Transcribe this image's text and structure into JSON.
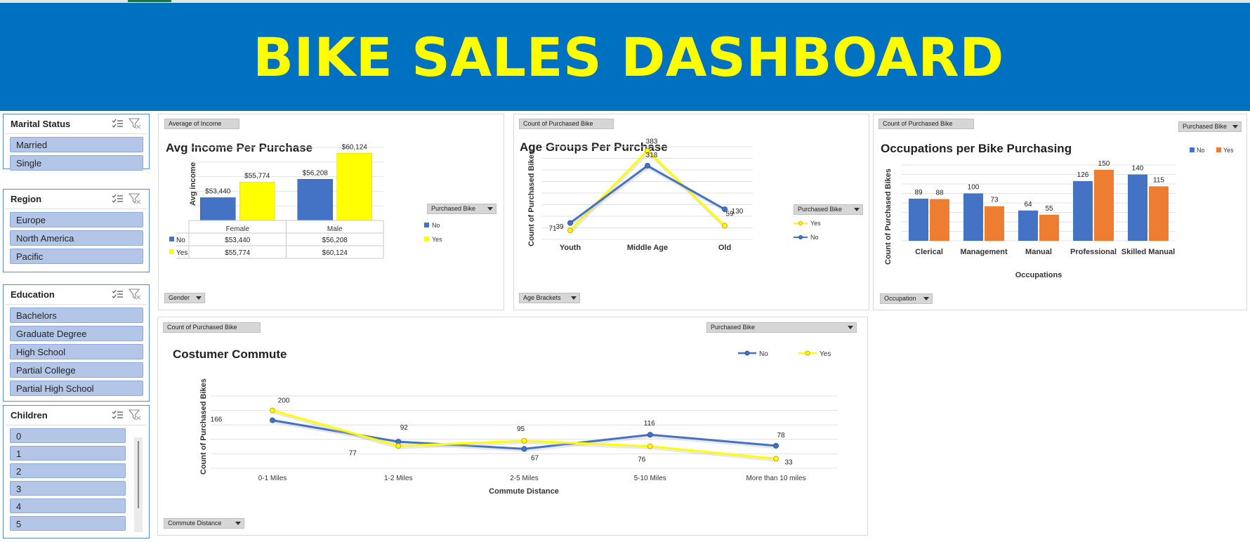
{
  "banner": {
    "title": "BIKE SALES DASHBOARD"
  },
  "colors": {
    "banner_bg": "#0070c0",
    "banner_text": "#ffff00",
    "no": "#4472c4",
    "yes_yellow": "#ffff00",
    "yes_orange": "#ed7d31",
    "slicer_item": "#b4c6e7"
  },
  "icons": {
    "multiselect": "multi-select-icon",
    "clear_filter": "clear-filter-icon",
    "dropdown": "dropdown-arrow-icon"
  },
  "slicers": {
    "marital": {
      "title": "Marital Status",
      "items": [
        "Married",
        "Single"
      ]
    },
    "region": {
      "title": "Region",
      "items": [
        "Europe",
        "North America",
        "Pacific"
      ]
    },
    "education": {
      "title": "Education",
      "items": [
        "Bachelors",
        "Graduate Degree",
        "High School",
        "Partial College",
        "Partial High School"
      ]
    },
    "children": {
      "title": "Children",
      "items": [
        "0",
        "1",
        "2",
        "3",
        "4",
        "5"
      ]
    }
  },
  "income_panel": {
    "field_value": "Average of Income",
    "field_axis": "Gender",
    "legend_title": "Purchased Bike",
    "table_rows": [
      {
        "key": "No",
        "cells": [
          "$53,440",
          "$56,208"
        ]
      },
      {
        "key": "Yes",
        "cells": [
          "$55,774",
          "$60,124"
        ]
      }
    ]
  },
  "age_panel": {
    "field_value": "Count of Purchased Bike",
    "field_axis": "Age Brackets",
    "legend_title": "Purchased Bike"
  },
  "occupation_panel": {
    "field_value": "Count of Purchased Bike",
    "field_axis": "Occupation",
    "field_legend": "Purchased Bike"
  },
  "commute_panel": {
    "field_value": "Count of Purchased Bike",
    "field_axis": "Commute Distance",
    "field_legend": "Purchased Bike"
  },
  "chart_data": [
    {
      "id": "income",
      "type": "bar",
      "title": "Avg Income Per Purchase",
      "ylabel": "Avg income",
      "xlabel": "",
      "categories": [
        "Female",
        "Male"
      ],
      "series": [
        {
          "name": "No",
          "values": [
            53440,
            56208
          ],
          "labels": [
            "$53,440",
            "$56,208"
          ],
          "color": "#4472c4"
        },
        {
          "name": "Yes",
          "values": [
            55774,
            60124
          ],
          "labels": [
            "$55,774",
            "$60,124"
          ],
          "color": "#ffff00"
        }
      ],
      "ylim": [
        50000,
        61000
      ],
      "grid": true,
      "legend": "right"
    },
    {
      "id": "age",
      "type": "line",
      "title": "Age Groups Per Purchase",
      "ylabel": "Count of Purchased Bikes",
      "xlabel": "",
      "categories": [
        "Youth",
        "Middle Age",
        "Old"
      ],
      "series": [
        {
          "name": "Yes",
          "values": [
            39,
            383,
            59
          ],
          "color": "#ffff00"
        },
        {
          "name": "No",
          "values": [
            71,
            318,
            130
          ],
          "color": "#4472c4"
        }
      ],
      "ylim": [
        0,
        400
      ],
      "grid": true,
      "legend": "right"
    },
    {
      "id": "occupation",
      "type": "bar",
      "title": "Occupations per Bike Purchasing",
      "ylabel": "Count of Purchased Bikes",
      "xlabel": "Occupations",
      "categories": [
        "Clerical",
        "Management",
        "Manual",
        "Professional",
        "Skilled Manual"
      ],
      "series": [
        {
          "name": "No",
          "values": [
            89,
            100,
            64,
            126,
            140
          ],
          "color": "#4472c4"
        },
        {
          "name": "Yes",
          "values": [
            88,
            73,
            55,
            150,
            115
          ],
          "color": "#ed7d31"
        }
      ],
      "ylim": [
        0,
        160
      ],
      "grid": true,
      "legend": "top-right"
    },
    {
      "id": "commute",
      "type": "line",
      "title": "Costumer Commute",
      "ylabel": "Count of Purchased Bikes",
      "xlabel": "Commute Distance",
      "categories": [
        "0-1 Miles",
        "1-2 Miles",
        "2-5 Miles",
        "5-10 Miles",
        "More than 10 miles"
      ],
      "series": [
        {
          "name": "No",
          "values": [
            166,
            92,
            67,
            116,
            78
          ],
          "color": "#4472c4"
        },
        {
          "name": "Yes",
          "values": [
            200,
            77,
            95,
            76,
            33
          ],
          "color": "#ffff00"
        }
      ],
      "ylim": [
        0,
        250
      ],
      "grid": true,
      "legend": "top-right"
    }
  ]
}
